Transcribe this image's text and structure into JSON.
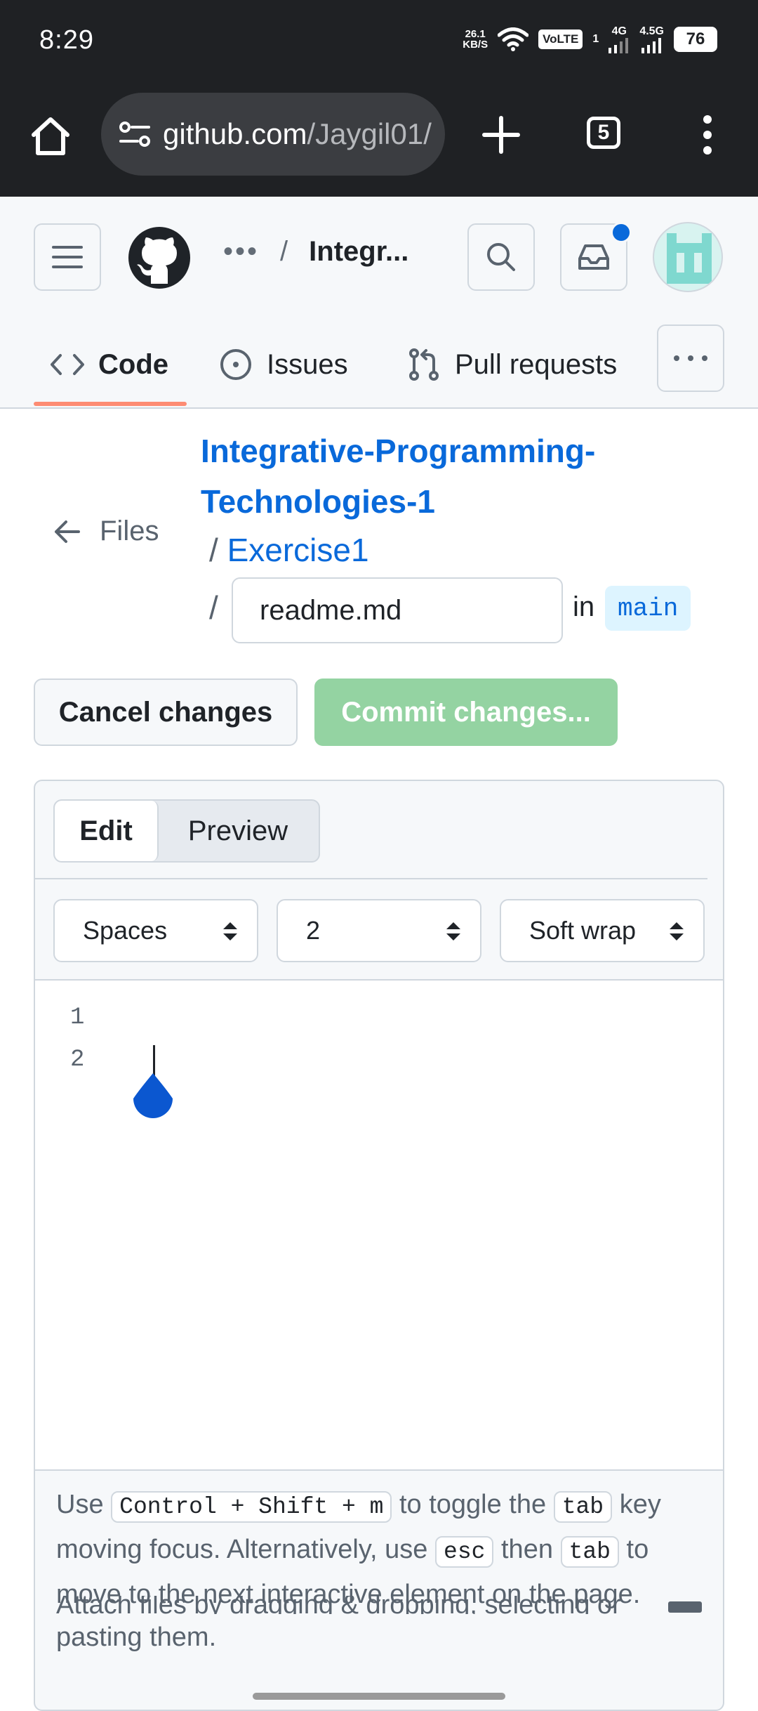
{
  "status_bar": {
    "time": "8:29",
    "net_speed_value": "26.1",
    "net_speed_unit": "KB/S",
    "volte": "VoLTE",
    "sim1_sup": "1",
    "net1": "4G",
    "net2": "4.5G",
    "battery": "76"
  },
  "browser": {
    "url_host": "github.com",
    "url_path": "/Jaygil01/",
    "tab_count": "5"
  },
  "header": {
    "breadcrumb_dots": "•••",
    "breadcrumb_sep": "/",
    "repo_short": "Integr..."
  },
  "repo_tabs": {
    "code": "Code",
    "issues": "Issues",
    "pull_requests": "Pull requests"
  },
  "file_path": {
    "back_label": "Files",
    "repo_name_line1": "Integrative-Programming-",
    "repo_name_line2": "Technologies-1",
    "sep": "/",
    "folder": "Exercise1",
    "file_name": "readme.md",
    "in_label": "in",
    "branch": "main"
  },
  "actions": {
    "cancel": "Cancel changes",
    "commit": "Commit changes..."
  },
  "editor": {
    "tab_edit": "Edit",
    "tab_preview": "Preview",
    "indent_mode": "Spaces",
    "indent_size": "2",
    "wrap_mode": "Soft wrap",
    "line_numbers": [
      "1",
      "2"
    ],
    "footer_use": "Use",
    "footer_kbd1": "Control + Shift + m",
    "footer_toggle": "to toggle the",
    "footer_kbd_tab": "tab",
    "footer_key": "key",
    "footer_moving": "moving focus. Alternatively, use",
    "footer_kbd_esc": "esc",
    "footer_then": "then",
    "footer_kbd_tab2": "tab",
    "footer_to": "to",
    "footer_last": "move to the next interactive element on the page.",
    "attach_line1": "Attach files by dragging & dropping, selecting or",
    "attach_line2": "pasting them."
  },
  "colors": {
    "accent_blue": "#0969da",
    "commit_disabled": "#94d3a2",
    "tab_underline": "#fd8c73",
    "chrome_dark": "#1f2124"
  },
  "icons": [
    "home-icon",
    "site-info-icon",
    "new-tab-icon",
    "tabs-count-icon",
    "more-vert-icon",
    "hamburger-icon",
    "github-logo-icon",
    "search-icon",
    "inbox-icon",
    "avatar",
    "code-icon",
    "issues-icon",
    "pull-request-icon",
    "kebab-icon",
    "arrow-left-icon",
    "updown-caret-icon",
    "markdown-icon"
  ]
}
